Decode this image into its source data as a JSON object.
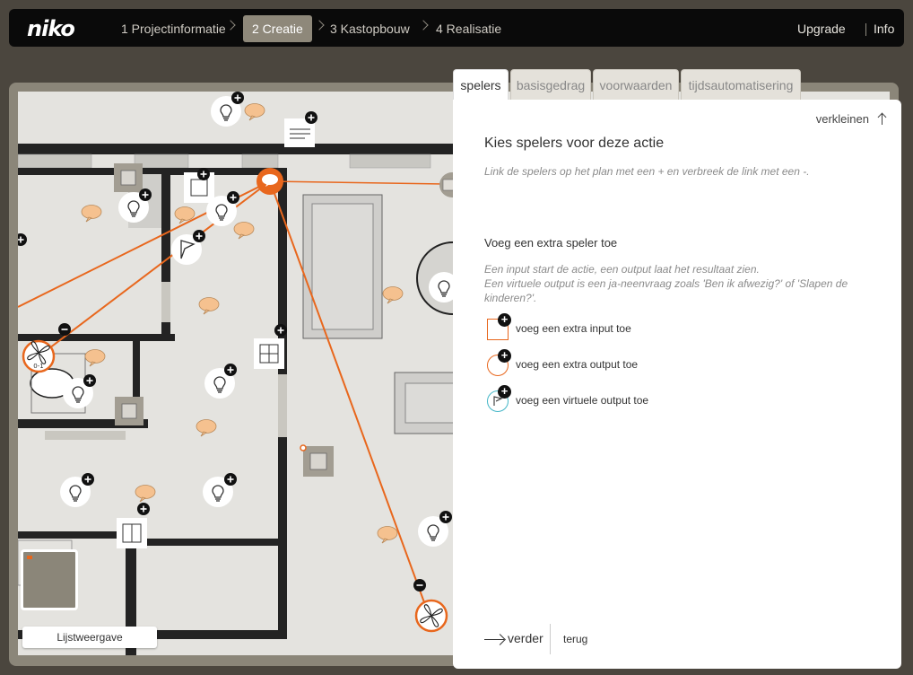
{
  "header": {
    "logo": "niko",
    "steps": [
      "1 Projectinformatie",
      "2 Creatie",
      "3 Kastopbouw",
      "4 Realisatie"
    ],
    "active_step": 1,
    "links": [
      "Upgrade",
      "Info"
    ]
  },
  "plan": {
    "list_view_label": "Lijstweergave"
  },
  "panel": {
    "tabs": [
      "spelers",
      "basisgedrag",
      "voorwaarden",
      "tijdsautomatisering"
    ],
    "active_tab": 0,
    "collapse_label": "verkleinen",
    "title": "Kies spelers voor deze actie",
    "hint": "Link de spelers op het plan met een + en verbreek de link met een -.",
    "subtitle": "Voeg een extra speler toe",
    "info_line1": "Een input start de actie, een output laat het resultaat zien.",
    "info_line2": "Een virtuele output is een ja-neenvraag zoals 'Ben ik afwezig?' of 'Slapen de kinderen?'.",
    "add_input": "voeg een extra input toe",
    "add_output": "voeg een extra output toe",
    "add_virtual": "voeg een virtuele output toe",
    "next_label": "verder",
    "back_label": "terug"
  },
  "colors": {
    "accent": "#e8671d",
    "virtual": "#44b6c7",
    "topbar": "#0a0a0a",
    "frame": "#8b8679",
    "floor": "#e4e3df",
    "wall": "#232323"
  },
  "icons": {
    "bulb": "lightbulb-icon",
    "speech": "speech-bubble-icon",
    "switch": "switch-icon",
    "flag": "flag-icon",
    "fan": "fan-icon",
    "plus": "plus-icon",
    "minus": "minus-icon"
  }
}
